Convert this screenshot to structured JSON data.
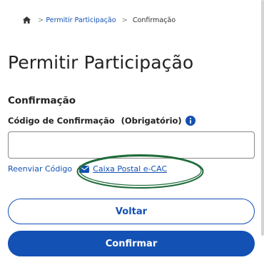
{
  "breadcrumb": {
    "home_icon": "home-icon",
    "items": [
      {
        "label": "Permitir Participação"
      },
      {
        "label": "Confirmação"
      }
    ]
  },
  "page": {
    "title": "Permitir Participação",
    "section_title": "Confirmação"
  },
  "form": {
    "code_label": "Código de Confirmação",
    "required_label": "(Obrigatório)",
    "info_icon": "info-icon",
    "code_value": "",
    "code_placeholder": ""
  },
  "links": {
    "resend_label": "Reenviar Código",
    "mailbox_label": "Caixa Postal e-CAC",
    "mailbox_icon": "envelope-icon"
  },
  "buttons": {
    "back_label": "Voltar",
    "confirm_label": "Confirmar"
  },
  "colors": {
    "primary": "#1351b4",
    "annotation": "#1e6b3a"
  }
}
